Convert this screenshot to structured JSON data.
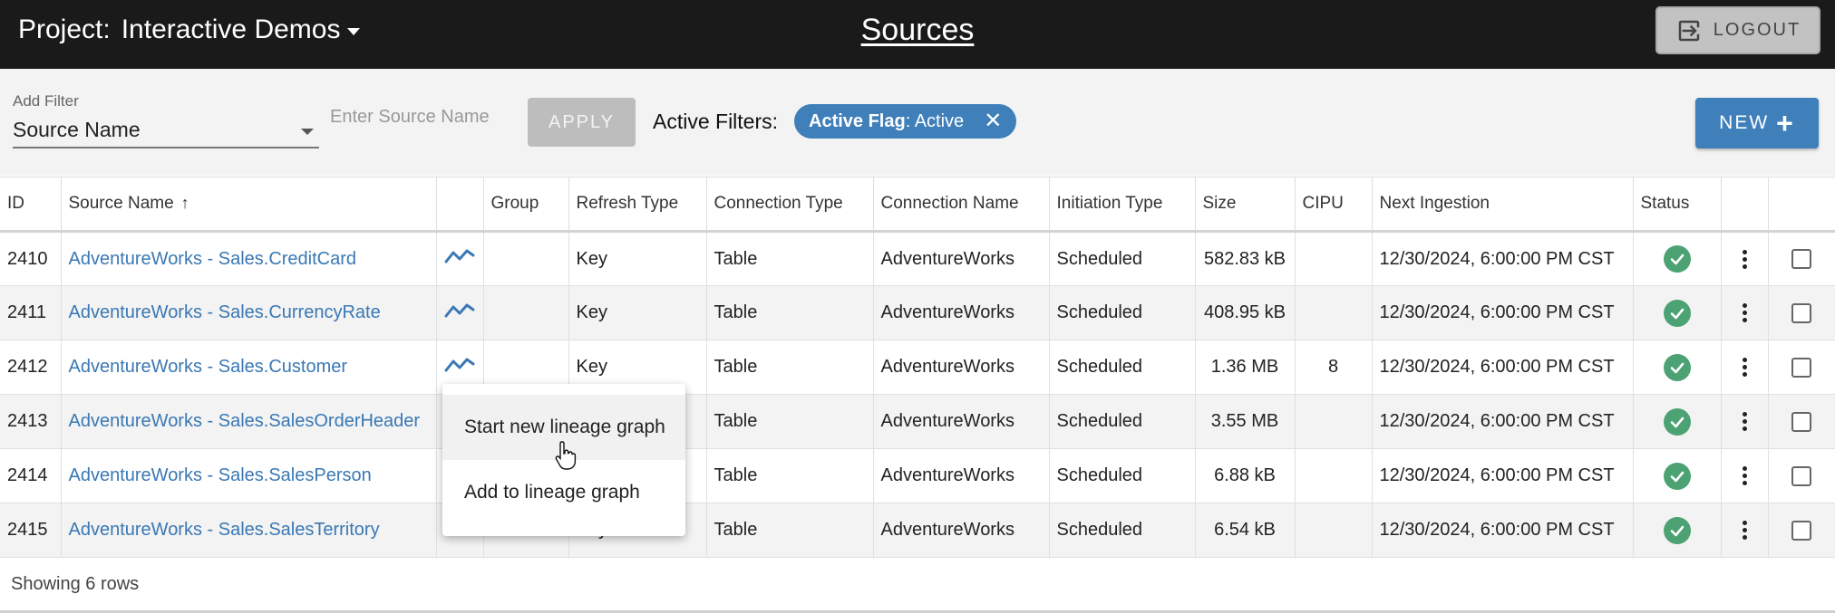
{
  "header": {
    "project_label": "Project:",
    "project_name": "Interactive Demos",
    "page_title": "Sources",
    "logout_label": "LOGOUT"
  },
  "filters": {
    "add_filter_label": "Add Filter",
    "selected_field": "Source Name",
    "input_placeholder": "Enter Source Name",
    "apply_label": "APPLY",
    "active_label": "Active Filters:",
    "chip_key": "Active Flag",
    "chip_value": ": Active",
    "new_label": "NEW"
  },
  "table": {
    "columns": [
      "ID",
      "Source Name",
      "",
      "Group",
      "Refresh Type",
      "Connection Type",
      "Connection Name",
      "Initiation Type",
      "Size",
      "CIPU",
      "Next Ingestion",
      "Status",
      "",
      ""
    ],
    "rows": [
      {
        "id": "2410",
        "name": "AdventureWorks - Sales.CreditCard",
        "group": "",
        "refresh": "Key",
        "conn_type": "Table",
        "conn_name": "AdventureWorks",
        "init": "Scheduled",
        "size": "582.83 kB",
        "cipu": "",
        "next": "12/30/2024, 6:00:00 PM CST"
      },
      {
        "id": "2411",
        "name": "AdventureWorks - Sales.CurrencyRate",
        "group": "",
        "refresh": "Key",
        "conn_type": "Table",
        "conn_name": "AdventureWorks",
        "init": "Scheduled",
        "size": "408.95 kB",
        "cipu": "",
        "next": "12/30/2024, 6:00:00 PM CST"
      },
      {
        "id": "2412",
        "name": "AdventureWorks - Sales.Customer",
        "group": "",
        "refresh": "Key",
        "conn_type": "Table",
        "conn_name": "AdventureWorks",
        "init": "Scheduled",
        "size": "1.36 MB",
        "cipu": "8",
        "next": "12/30/2024, 6:00:00 PM CST"
      },
      {
        "id": "2413",
        "name": "AdventureWorks - Sales.SalesOrderHeader",
        "group": "",
        "refresh": "",
        "conn_type": "Table",
        "conn_name": "AdventureWorks",
        "init": "Scheduled",
        "size": "3.55 MB",
        "cipu": "",
        "next": "12/30/2024, 6:00:00 PM CST"
      },
      {
        "id": "2414",
        "name": "AdventureWorks - Sales.SalesPerson",
        "group": "",
        "refresh": "",
        "conn_type": "Table",
        "conn_name": "AdventureWorks",
        "init": "Scheduled",
        "size": "6.88 kB",
        "cipu": "",
        "next": "12/30/2024, 6:00:00 PM CST"
      },
      {
        "id": "2415",
        "name": "AdventureWorks - Sales.SalesTerritory",
        "group": "",
        "refresh": "Key",
        "conn_type": "Table",
        "conn_name": "AdventureWorks",
        "init": "Scheduled",
        "size": "6.54 kB",
        "cipu": "",
        "next": "12/30/2024, 6:00:00 PM CST"
      }
    ]
  },
  "footer": {
    "row_count": "Showing 6 rows"
  },
  "context_menu": {
    "items": [
      "Start new lineage graph",
      "Add to lineage graph"
    ]
  },
  "icons": {
    "lineage": "lineage-chart-icon",
    "status": "check-circle-icon",
    "more": "more-vertical-icon",
    "logout": "logout-icon"
  },
  "colors": {
    "accent": "#3f7fba",
    "status_ok": "#4ca273",
    "topbar": "#1a1a1a"
  }
}
